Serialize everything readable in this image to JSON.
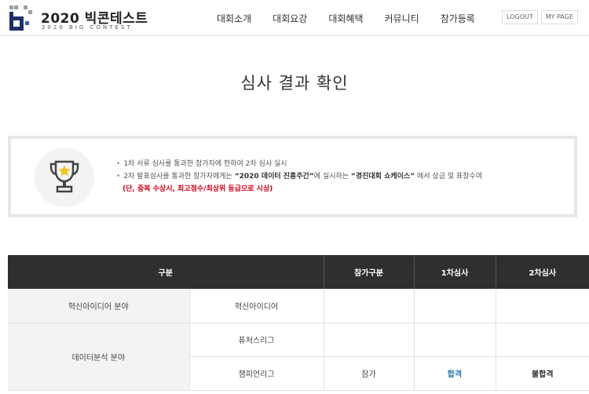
{
  "header": {
    "logo_title": "2020 빅콘테스트",
    "logo_subtitle": "2020 BIG CONTEST",
    "nav": [
      "대회소개",
      "대회요강",
      "대회혜택",
      "커뮤니티",
      "참가등록"
    ],
    "logout_label": "LOGOUT",
    "mypage_label": "MY PAGE"
  },
  "page_title": "심사 결과 확인",
  "notice": {
    "line1": "1차 서류 심사를 통과한 참가자에 한하여 2차 심사 실시",
    "line2_prefix": "2차 발표심사를 통과한 참가자에게는 ",
    "line2_event": "“2020 데이터 진흥주간”",
    "line2_mid": "에 실시하는 ",
    "line2_showcase": "“경진대회 쇼케이스”",
    "line2_suffix": " 에서 상금 및 표창수여",
    "line3": "(단, 중복 수상시, 최고점수/최상위 등급으로 시상)"
  },
  "table": {
    "headers": {
      "category": "구분",
      "participation": "참가구분",
      "first": "1차심사",
      "second": "2차심사"
    },
    "rows": [
      {
        "field": "혁신아이디어 분야",
        "league": "혁신아이디어",
        "participation": "",
        "first": "",
        "second": ""
      },
      {
        "field": "데이터분석 분야",
        "league": "퓨처스리그",
        "participation": "",
        "first": "",
        "second": ""
      },
      {
        "field": "",
        "league": "챔피언리그",
        "participation": "참가",
        "first": "합격",
        "second": "불합격"
      }
    ]
  }
}
